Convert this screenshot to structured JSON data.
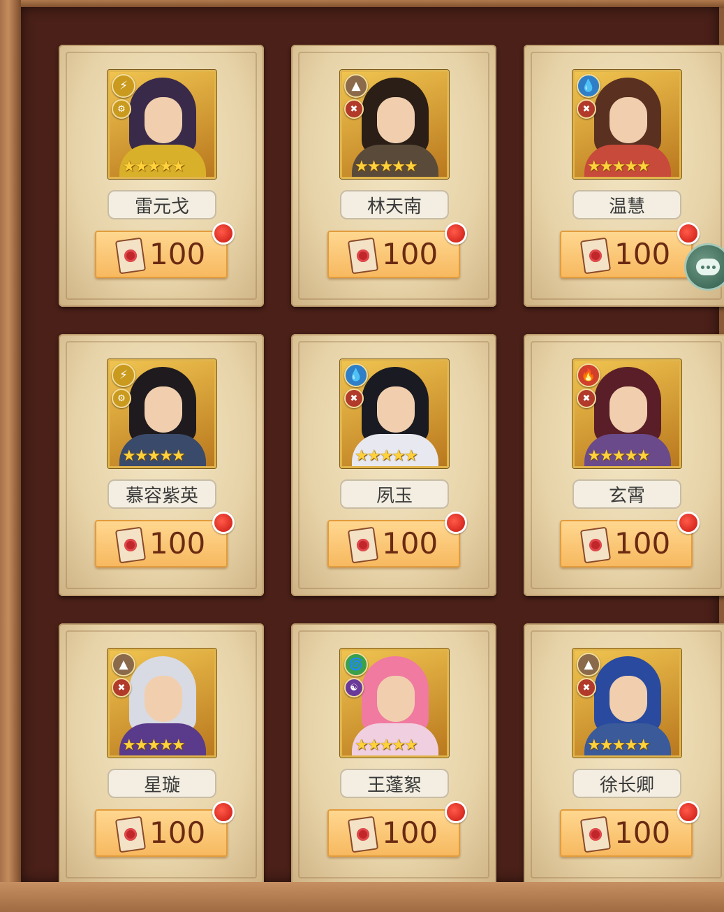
{
  "heroes": [
    {
      "name": "雷元戈",
      "element": "lightning",
      "element_icon": "⚡",
      "element_color": "#c99a1e",
      "class_icon": "⚙",
      "class_color": "#c99a1e",
      "stars": "★★★★★",
      "price": "100",
      "hair": "#3a2a4a",
      "clothes": "#d8b02a"
    },
    {
      "name": "林天南",
      "element": "earth",
      "element_icon": "▲",
      "element_color": "#8a6a4a",
      "class_icon": "✖",
      "class_color": "#b23a2a",
      "stars": "★★★★★",
      "price": "100",
      "hair": "#2a1e16",
      "clothes": "#5a4a3a"
    },
    {
      "name": "温慧",
      "element": "water",
      "element_icon": "💧",
      "element_color": "#2e7fc8",
      "class_icon": "✖",
      "class_color": "#b23a2a",
      "stars": "★★★★★",
      "price": "100",
      "hair": "#5a3020",
      "clothes": "#c84a3a"
    },
    {
      "name": "慕容紫英",
      "element": "lightning",
      "element_icon": "⚡",
      "element_color": "#c99a1e",
      "class_icon": "⚙",
      "class_color": "#c99a1e",
      "stars": "★★★★★",
      "price": "100",
      "hair": "#1e1a1e",
      "clothes": "#3a4a6a"
    },
    {
      "name": "夙玉",
      "element": "water",
      "element_icon": "💧",
      "element_color": "#2e7fc8",
      "class_icon": "✖",
      "class_color": "#b23a2a",
      "stars": "★★★★★",
      "price": "100",
      "hair": "#1a1a22",
      "clothes": "#e8e8f0"
    },
    {
      "name": "玄霄",
      "element": "fire",
      "element_icon": "🔥",
      "element_color": "#d0402a",
      "class_icon": "✖",
      "class_color": "#b23a2a",
      "stars": "★★★★★",
      "price": "100",
      "hair": "#5a1e28",
      "clothes": "#6a4a8a"
    },
    {
      "name": "星璇",
      "element": "earth",
      "element_icon": "▲",
      "element_color": "#8a6a4a",
      "class_icon": "✖",
      "class_color": "#b23a2a",
      "stars": "★★★★★",
      "price": "100",
      "hair": "#d8dae4",
      "clothes": "#5a3a8a"
    },
    {
      "name": "王蓬絮",
      "element": "wind",
      "element_icon": "🌀",
      "element_color": "#3aa04a",
      "class_icon": "☯",
      "class_color": "#6a3a9a",
      "stars": "★★★★★",
      "price": "100",
      "hair": "#f07aa0",
      "clothes": "#f0d0e0"
    },
    {
      "name": "徐长卿",
      "element": "earth",
      "element_icon": "▲",
      "element_color": "#8a6a4a",
      "class_icon": "✖",
      "class_color": "#b23a2a",
      "stars": "★★★★★",
      "price": "100",
      "hair": "#2a4aa0",
      "clothes": "#3a5a9a"
    }
  ],
  "chat": {
    "icon": "chat-bubble-icon"
  }
}
